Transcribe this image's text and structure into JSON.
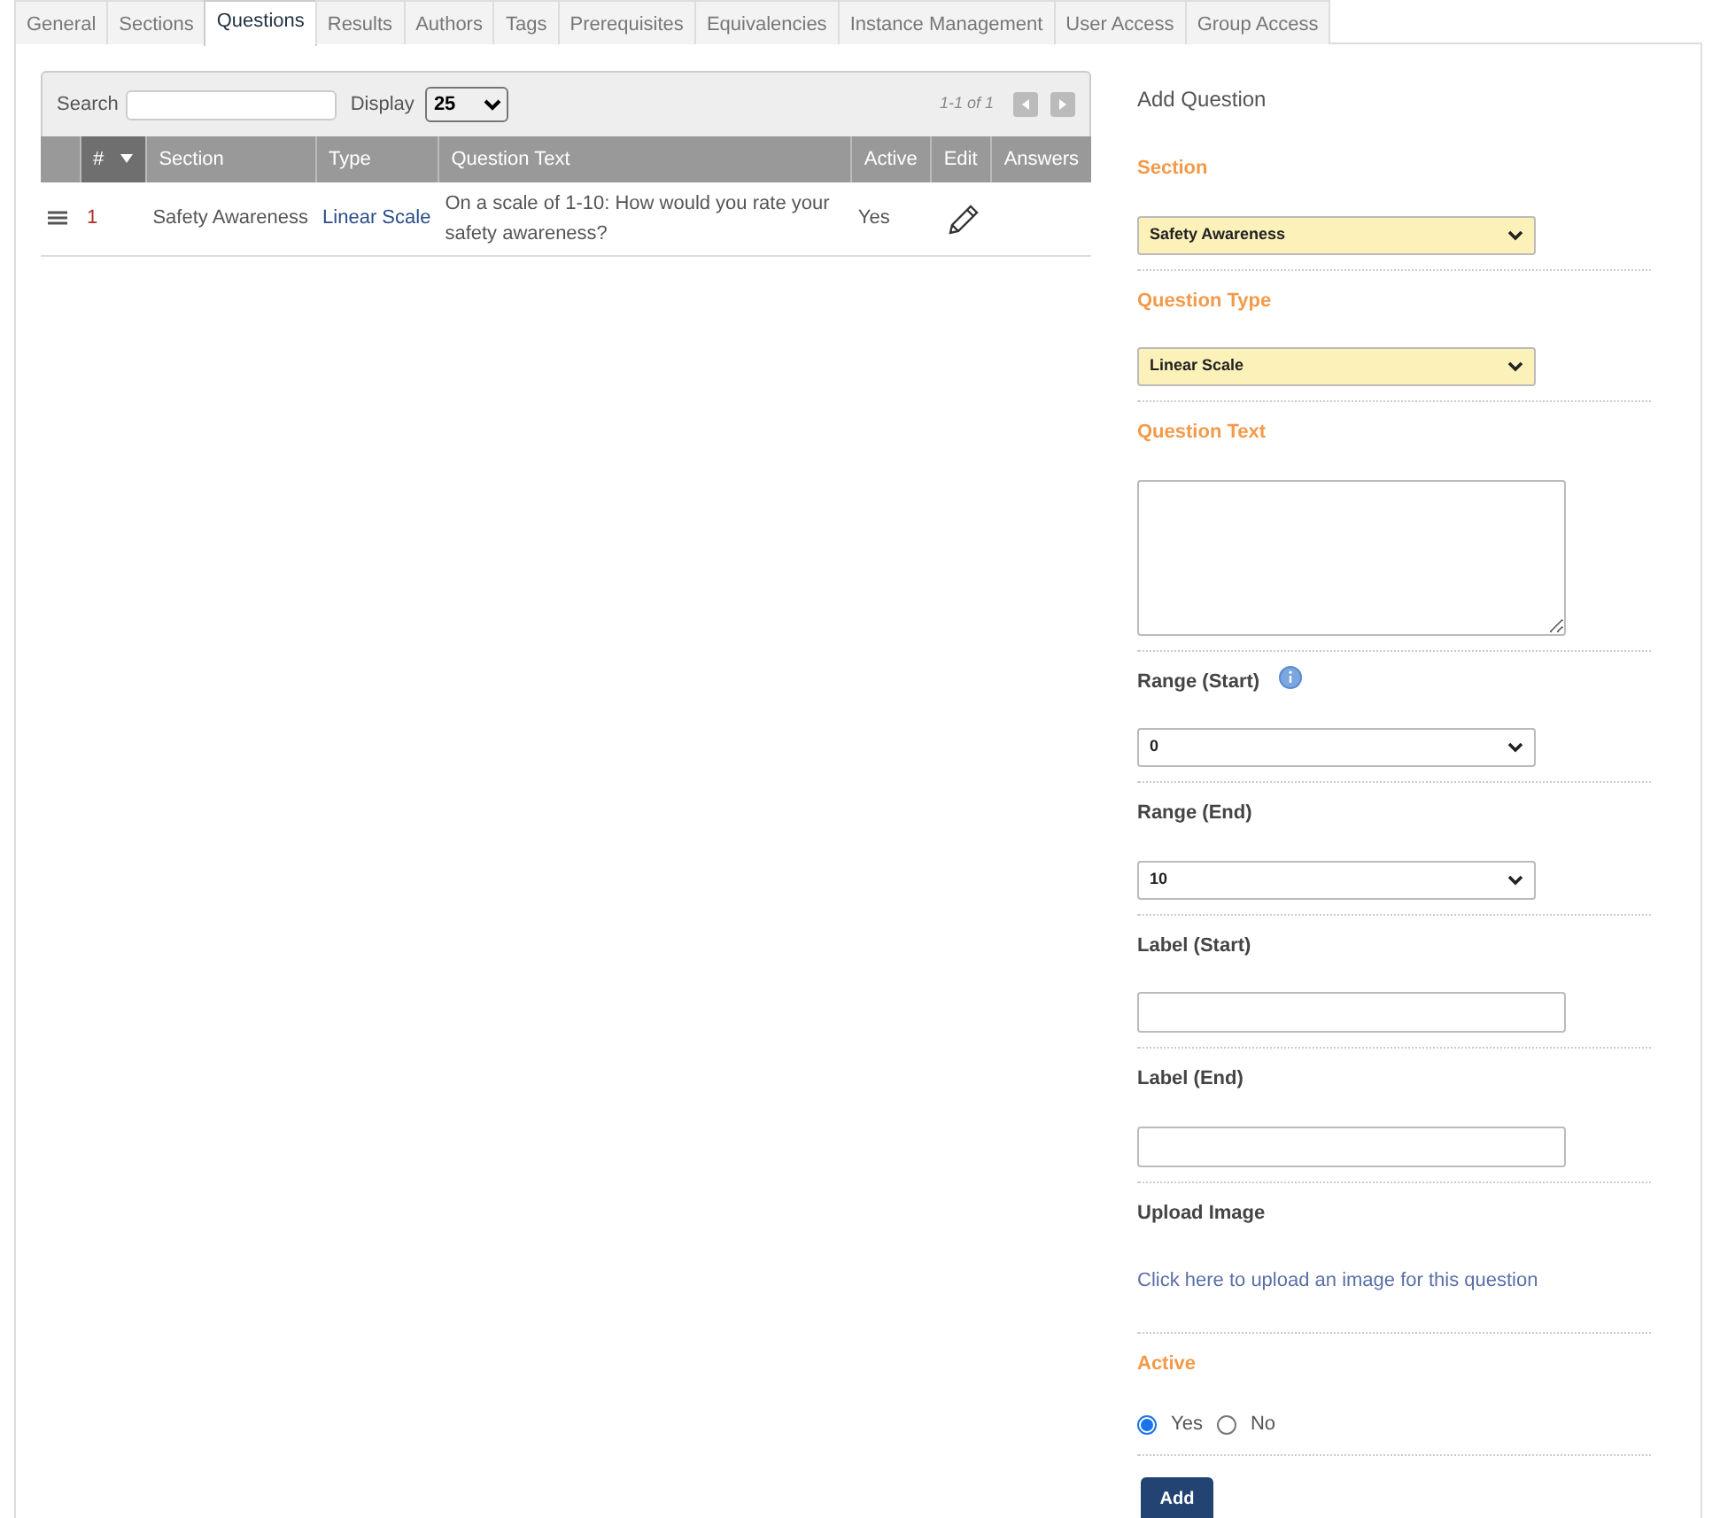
{
  "tabs": [
    {
      "label": "General",
      "selected": false
    },
    {
      "label": "Sections",
      "selected": false
    },
    {
      "label": "Questions",
      "selected": true
    },
    {
      "label": "Results",
      "selected": false
    },
    {
      "label": "Authors",
      "selected": false
    },
    {
      "label": "Tags",
      "selected": false
    },
    {
      "label": "Prerequisites",
      "selected": false
    },
    {
      "label": "Equivalencies",
      "selected": false
    },
    {
      "label": "Instance Management",
      "selected": false
    },
    {
      "label": "User Access",
      "selected": false
    },
    {
      "label": "Group Access",
      "selected": false
    }
  ],
  "grid": {
    "search_label": "Search",
    "display_label": "Display",
    "display_value": "25",
    "pager": "1-1 of 1",
    "columns": [
      {
        "label": "#",
        "sorted": true
      },
      {
        "label": "Section",
        "sorted": false
      },
      {
        "label": "Type",
        "sorted": false
      },
      {
        "label": "Question Text",
        "sorted": false
      },
      {
        "label": "Active",
        "sorted": false
      },
      {
        "label": "Edit",
        "sorted": false
      },
      {
        "label": "Answers",
        "sorted": false
      }
    ],
    "rows": [
      {
        "number": "1",
        "section": "Safety Awareness",
        "type": "Linear Scale",
        "question_text": "On a scale of 1-10: How would you rate your safety awareness?",
        "active": "Yes"
      }
    ]
  },
  "form": {
    "title": "Add Question",
    "fields": [
      {
        "kind": "select",
        "label": "Section",
        "required": true,
        "value": "Safety Awareness",
        "highlighted": true
      },
      {
        "kind": "select",
        "label": "Question Type",
        "required": true,
        "value": "Linear Scale",
        "highlighted": true
      },
      {
        "kind": "textarea",
        "label": "Question Text",
        "required": true
      },
      {
        "kind": "select",
        "label": "Range (Start)",
        "required": false,
        "value": "0",
        "highlighted": false,
        "info": true
      },
      {
        "kind": "select",
        "label": "Range (End)",
        "required": false,
        "value": "10",
        "highlighted": false
      },
      {
        "kind": "input",
        "label": "Label (Start)",
        "required": false
      },
      {
        "kind": "input",
        "label": "Label (End)",
        "required": false
      },
      {
        "kind": "link",
        "label": "Upload Image",
        "required": false,
        "link": "Click here to upload an image for this question"
      },
      {
        "kind": "radio",
        "label": "Active",
        "required": true,
        "options": [
          {
            "label": "Yes",
            "selected": true
          },
          {
            "label": "No",
            "selected": false
          }
        ]
      }
    ],
    "submit": "Add"
  }
}
